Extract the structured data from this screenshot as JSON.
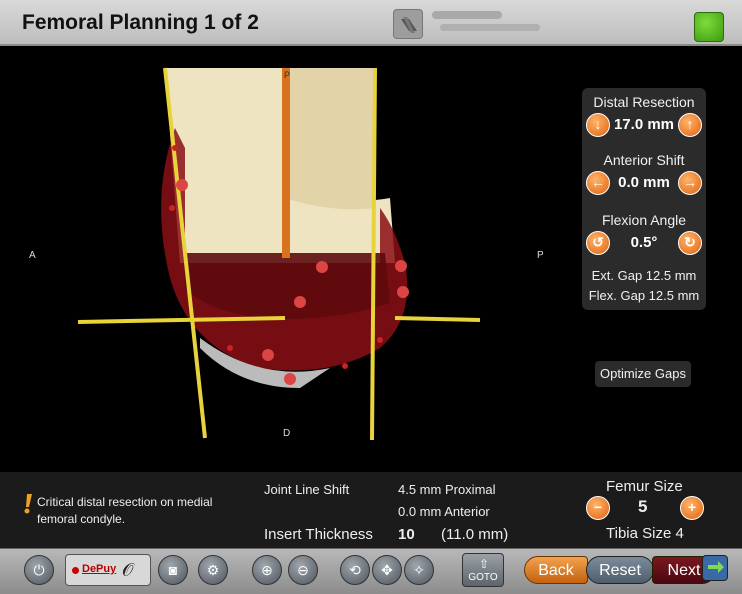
{
  "header": {
    "title": "Femoral Planning 1 of 2",
    "status_color": "#4caf1f"
  },
  "viewport": {
    "labels": {
      "anterior": "A",
      "posterior": "P",
      "distal": "D",
      "top_marker": "P"
    }
  },
  "controls": {
    "distal_resection": {
      "label": "Distal Resection",
      "value": "17.0 mm",
      "decrease_icon": "arrow-down-icon",
      "increase_icon": "arrow-up-icon"
    },
    "anterior_shift": {
      "label": "Anterior Shift",
      "value": "0.0 mm",
      "decrease_icon": "arrow-left-icon",
      "increase_icon": "arrow-right-icon"
    },
    "flexion_angle": {
      "label": "Flexion Angle",
      "value": "0.5°",
      "decrease_icon": "rotate-ccw-icon",
      "increase_icon": "rotate-cw-icon"
    },
    "ext_gap": "Ext. Gap  12.5 mm",
    "flex_gap": "Flex. Gap 12.5 mm",
    "optimize_label": "Optimize Gaps"
  },
  "info": {
    "warning": "Critical distal resection on medial femoral condyle.",
    "joint_line_label": "Joint Line Shift",
    "joint_line_proximal": "4.5 mm Proximal",
    "joint_line_anterior": "0.0 mm Anterior",
    "insert_label": "Insert Thickness",
    "insert_value": "10",
    "insert_mm": "(11.0 mm)",
    "femur_label": "Femur Size",
    "femur_value": "5",
    "tibia_label": "Tibia Size 4"
  },
  "toolbar": {
    "brand": "DePuy",
    "goto_label": "GOTO",
    "back_label": "Back",
    "reset_label": "Reset",
    "next_label": "Next",
    "accent": "#e0620e"
  }
}
